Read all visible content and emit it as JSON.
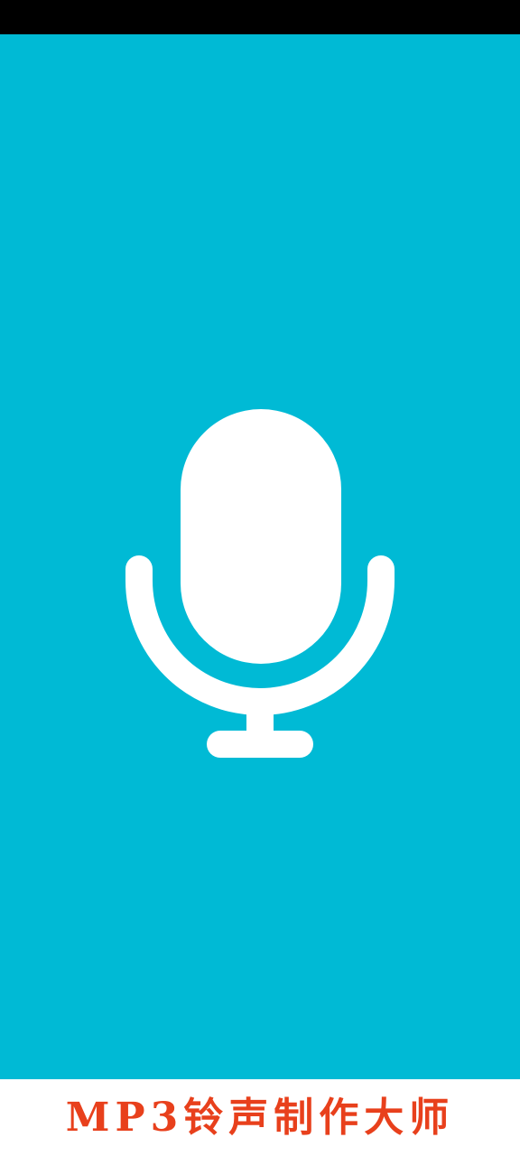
{
  "app": {
    "name": "MP3铃声制作大师"
  },
  "splash": {
    "icon": "microphone-icon"
  },
  "colors": {
    "status_bar": "#000000",
    "splash_background": "#00BAD5",
    "icon": "#FFFFFF",
    "footer_background": "#FFFFFF",
    "app_name_text": "#E8401C"
  }
}
